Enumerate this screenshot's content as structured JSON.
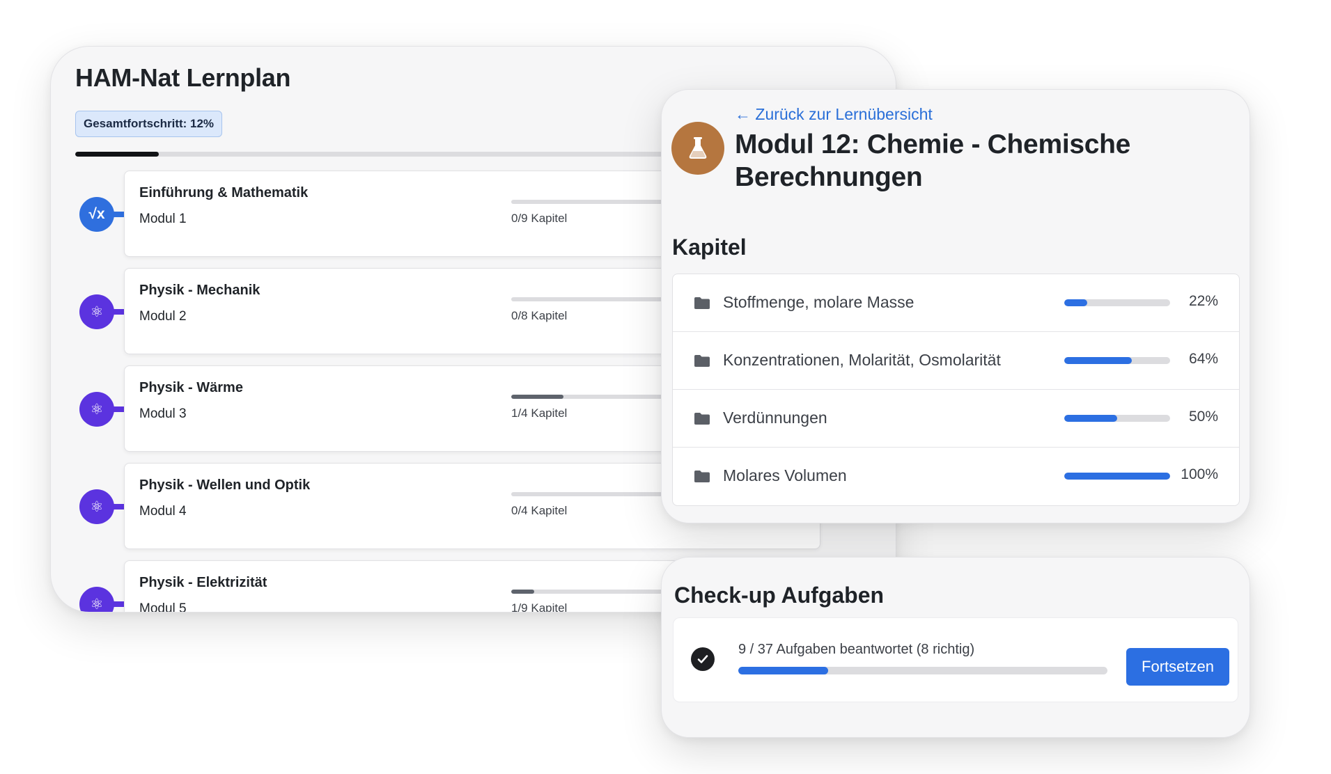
{
  "plan": {
    "title": "HAM-Nat Lernplan",
    "overall_progress_label": "Gesamtfortschritt: 12%",
    "overall_progress": 0.12,
    "modules": [
      {
        "name": "Einführung & Mathematik",
        "sub": "Modul 1",
        "kapitel": "0/9 Kapitel",
        "progress": 0,
        "icon": "square-root-icon",
        "icon_glyph": "√x",
        "color": "#2f6fde"
      },
      {
        "name": "Physik - Mechanik",
        "sub": "Modul 2",
        "kapitel": "0/8 Kapitel",
        "progress": 0,
        "icon": "atom-icon",
        "icon_glyph": "⚛",
        "color": "#5b33df"
      },
      {
        "name": "Physik - Wärme",
        "sub": "Modul 3",
        "kapitel": "1/4 Kapitel",
        "progress": 0.25,
        "icon": "atom-icon",
        "icon_glyph": "⚛",
        "color": "#5b33df"
      },
      {
        "name": "Physik - Wellen und Optik",
        "sub": "Modul 4",
        "kapitel": "0/4 Kapitel",
        "progress": 0,
        "icon": "atom-icon",
        "icon_glyph": "⚛",
        "color": "#5b33df"
      },
      {
        "name": "Physik - Elektrizität",
        "sub": "Modul 5",
        "kapitel": "1/9 Kapitel",
        "progress": 0.11,
        "icon": "atom-icon",
        "icon_glyph": "⚛",
        "color": "#5b33df"
      }
    ]
  },
  "module_detail": {
    "back_link": "← Zurück zur Lernübersicht",
    "title": "Modul 12: Chemie - Chemische Berechnungen",
    "icon": "flask-icon",
    "icon_color": "#b5763f",
    "kapitel_heading": "Kapitel",
    "chapters": [
      {
        "name": "Stoffmenge, molare Masse",
        "percent_label": "22%",
        "progress": 0.22
      },
      {
        "name": "Konzentrationen, Molarität, Osmolarität",
        "percent_label": "64%",
        "progress": 0.64
      },
      {
        "name": "Verdünnungen",
        "percent_label": "50%",
        "progress": 0.5
      },
      {
        "name": "Molares Volumen",
        "percent_label": "100%",
        "progress": 1.0
      }
    ]
  },
  "checkup": {
    "heading": "Check-up Aufgaben",
    "status": "9 / 37 Aufgaben beantwortet (8 richtig)",
    "progress": 0.243,
    "button_label": "Fortsetzen"
  },
  "colors": {
    "accent": "#2c6fe2",
    "physics": "#5b33df",
    "math": "#2f6fde",
    "chemistry": "#b5763f"
  }
}
